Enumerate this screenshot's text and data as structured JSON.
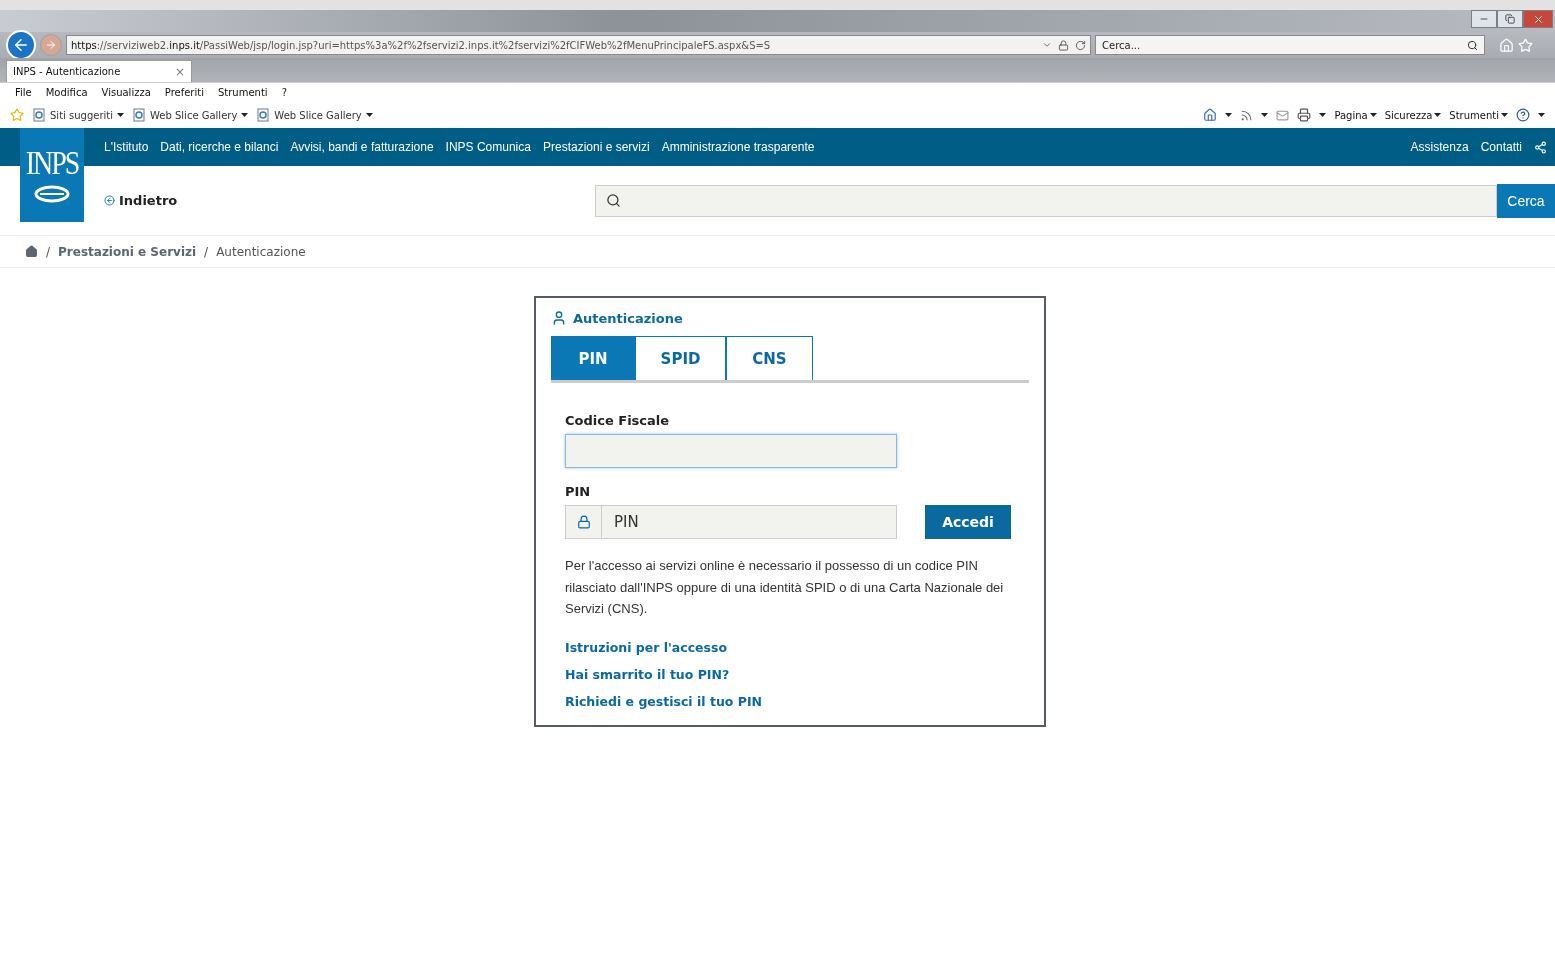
{
  "browser": {
    "url": "**https**://serviziweb2.**inps.it**/PassiWeb/jsp/login.jsp?uri=https%3a%2f%2fservizi2.inps.it%2fservizi%2fCIFWeb%2fMenuPrincipaleFS.aspx&S=S",
    "search_placeholder": "Cerca...",
    "tab": {
      "title": "INPS - Autenticazione",
      "close": "×"
    },
    "menu": [
      "File",
      "Modifica",
      "Visualizza",
      "Preferiti",
      "Strumenti",
      "?"
    ],
    "favorites": [
      "Siti suggeriti",
      "Web Slice Gallery",
      "Web Slice Gallery"
    ],
    "command_bar": [
      "Pagina",
      "Sicurezza",
      "Strumenti"
    ]
  },
  "site": {
    "logo": "INPS",
    "nav": [
      "L'Istituto",
      "Dati, ricerche e bilanci",
      "Avvisi, bandi e fatturazione",
      "INPS Comunica",
      "Prestazioni e servizi",
      "Amministrazione trasparente"
    ],
    "nav_right": [
      "Assistenza",
      "Contatti"
    ],
    "breadcrumb_separator": "/",
    "back_link": "Indietro",
    "search_button": "Cerca",
    "breadcrumb": [
      {
        "kind": "home"
      },
      {
        "kind": "link",
        "label": "Prestazioni e Servizi"
      },
      {
        "kind": "current",
        "label": "Autenticazione"
      }
    ]
  },
  "login": {
    "title": "Autenticazione",
    "tabs": [
      {
        "label": "PIN",
        "selected": true
      },
      {
        "label": "SPID",
        "selected": false
      },
      {
        "label": "CNS",
        "selected": false
      }
    ],
    "fiscal_code": {
      "label": "Codice Fiscale",
      "focused": true
    },
    "pin": {
      "label": "PIN",
      "placeholder": "PIN"
    },
    "submit": "Accedi",
    "info": "Per l'accesso ai servizi online è necessario il possesso di un codice PIN rilasciato dall'INPS oppure di una identità SPID o di una Carta Nazionale dei Servizi (CNS).",
    "links": [
      "Istruzioni per l'accesso",
      "Hai smarrito il tuo PIN?",
      "Richiedi e gestisci il tuo PIN"
    ]
  }
}
